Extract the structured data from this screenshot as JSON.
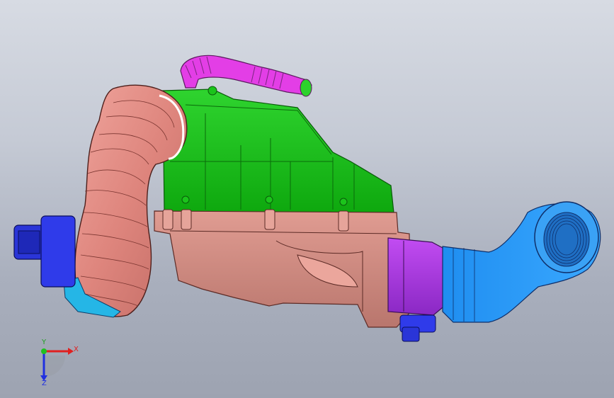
{
  "viewport": {
    "background_top": "#d7dbe3",
    "background_bottom": "#9da3b1"
  },
  "model": {
    "parts": [
      {
        "name": "intake-hose-corrugated",
        "color": "#e08a82"
      },
      {
        "name": "airbox-cover",
        "color": "#16c016"
      },
      {
        "name": "airbox-housing",
        "color": "#d08a80"
      },
      {
        "name": "breather-hose",
        "color": "#e23ae6"
      },
      {
        "name": "throttle-body",
        "color": "#a13bd8"
      },
      {
        "name": "outlet-elbow",
        "color": "#2f86e8"
      },
      {
        "name": "sensor-connector-left",
        "color": "#2a35d8"
      },
      {
        "name": "sensor-connector-right",
        "color": "#2a35d8"
      },
      {
        "name": "bracket",
        "color": "#25b6e6"
      }
    ]
  },
  "triad": {
    "x_label": "X",
    "y_label": "Y",
    "z_label": "Z",
    "x_color": "#e02020",
    "y_color": "#20c020",
    "z_color": "#2030e0"
  }
}
